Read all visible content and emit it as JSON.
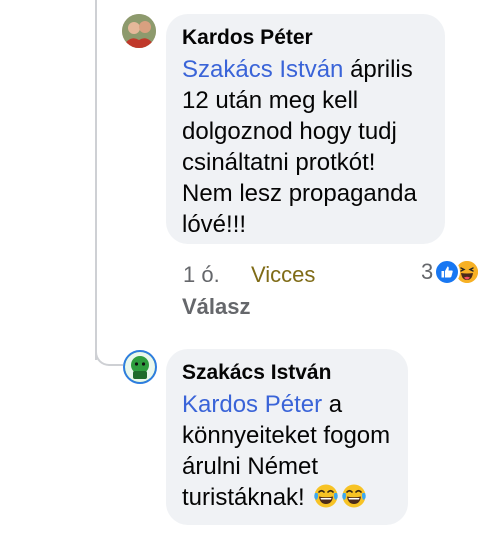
{
  "comments": [
    {
      "author": "Kardos Péter",
      "mention": "Szakács István",
      "text": " április 12 után meg kell dolgoznod hogy tudj csináltatni protkót! Nem lesz propaganda lóvé!!!",
      "time": "1 ó.",
      "reaction_label": "Vicces",
      "reply_label": "Válasz",
      "reaction_count": "3",
      "reaction_icons": [
        "like-icon",
        "haha-icon"
      ]
    },
    {
      "author": "Szakács István",
      "mention": "Kardos Péter",
      "text": " a könnyeiteket fogom árulni Német turistáknak! ",
      "emojis": [
        "tears-of-joy-icon",
        "tears-of-joy-icon"
      ]
    }
  ],
  "colors": {
    "mention": "#3a64d8",
    "bubble": "#f0f2f5",
    "vicces": "#7f6b16",
    "like": "#1877f2",
    "haha": "#f7b125"
  }
}
